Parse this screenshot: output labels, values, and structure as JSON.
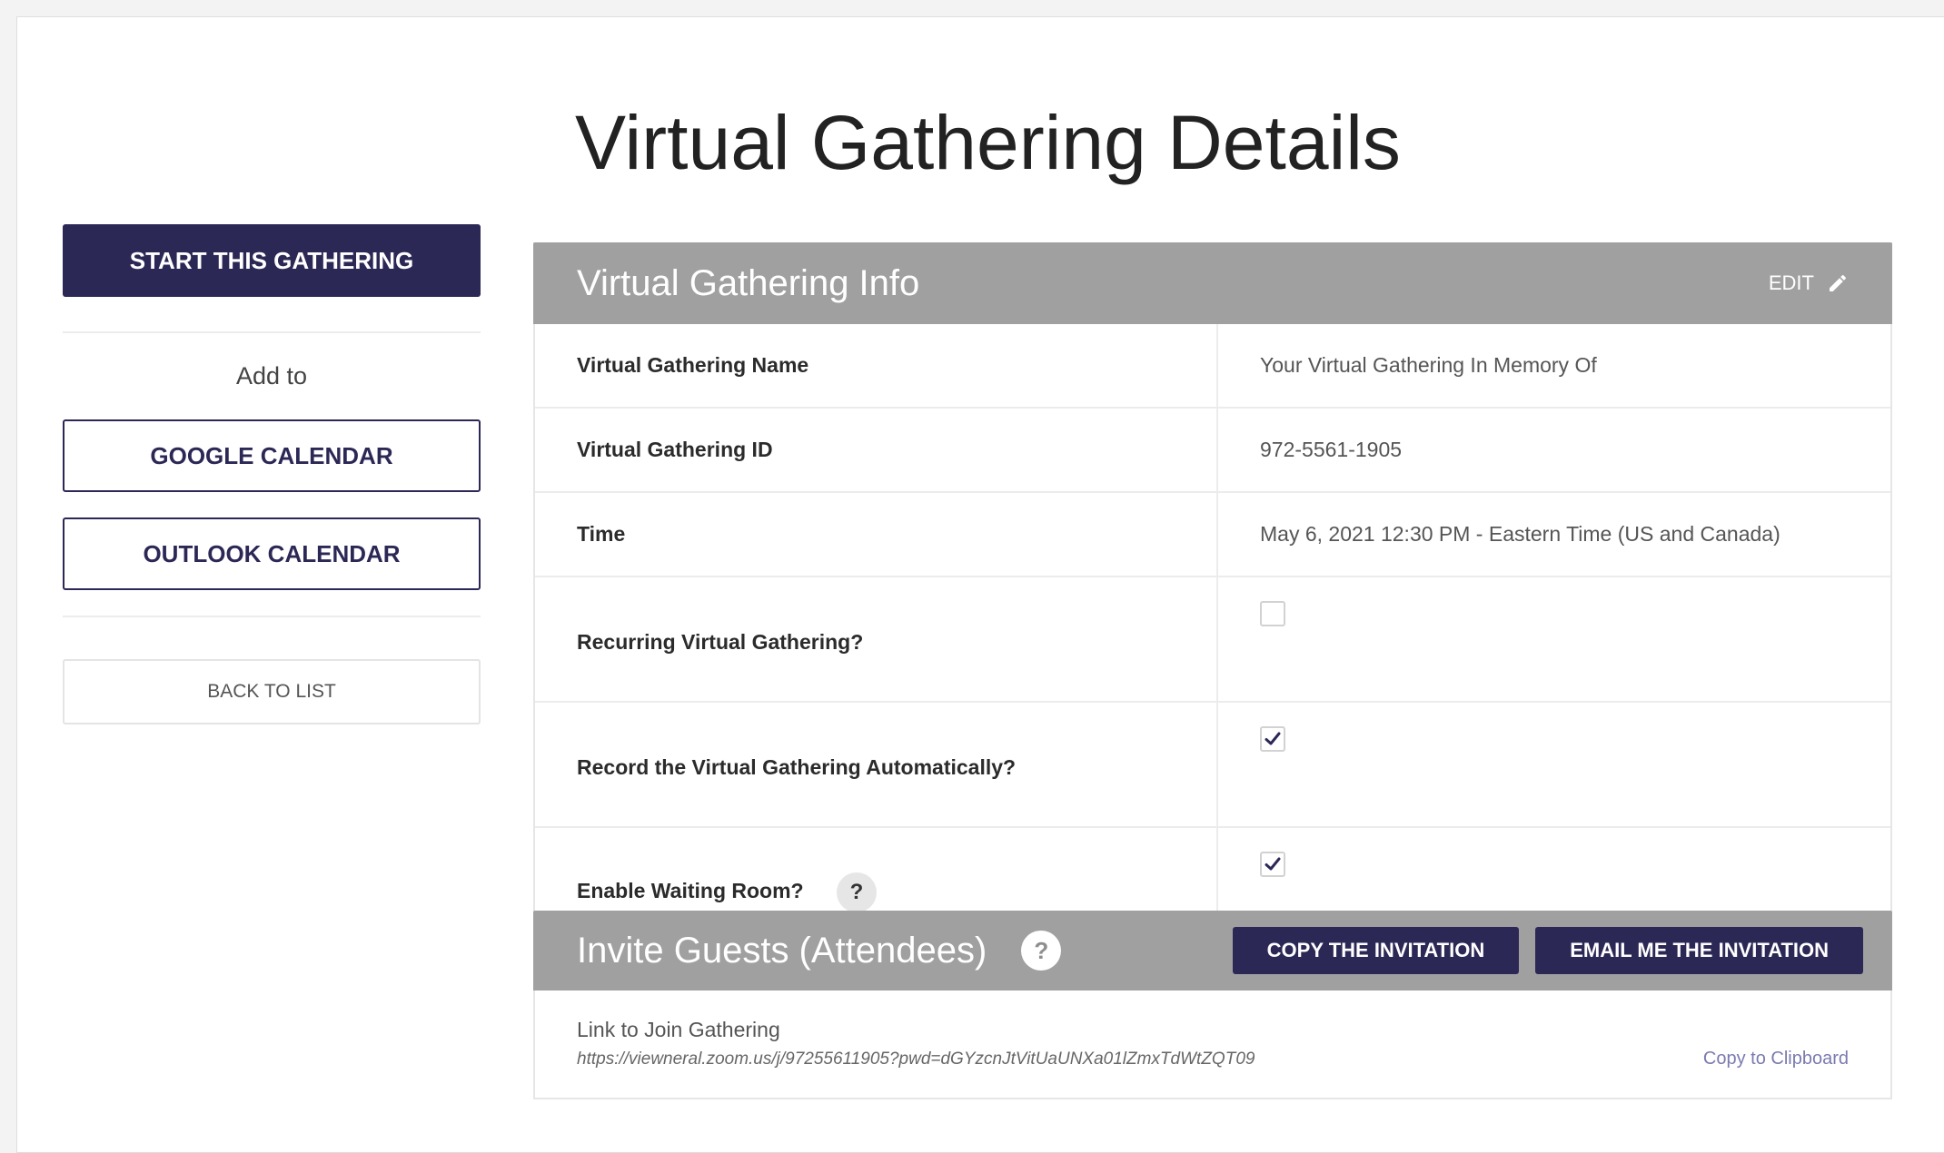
{
  "page": {
    "title": "Virtual Gathering Details"
  },
  "sidebar": {
    "start_label": "START THIS GATHERING",
    "add_to_label": "Add to",
    "google_calendar_label": "GOOGLE CALENDAR",
    "outlook_calendar_label": "OUTLOOK CALENDAR",
    "back_label": "BACK TO LIST"
  },
  "info": {
    "header_title": "Virtual Gathering Info",
    "edit_label": "EDIT",
    "edit_icon": "pencil-icon",
    "rows": [
      {
        "label": "Virtual Gathering Name",
        "value": "Your Virtual Gathering In Memory Of"
      },
      {
        "label": "Virtual Gathering ID",
        "value": "972-5561-1905"
      },
      {
        "label": "Time",
        "value": "May 6, 2021 12:30 PM - Eastern Time (US and Canada)"
      },
      {
        "label": "Recurring Virtual Gathering?",
        "checked": false
      },
      {
        "label": "Record the Virtual Gathering Automatically?",
        "checked": true
      },
      {
        "label": "Enable Waiting Room?",
        "checked": true,
        "help": "?"
      }
    ]
  },
  "invite": {
    "header_title": "Invite Guests (Attendees)",
    "help": "?",
    "copy_button": "COPY THE INVITATION",
    "email_button": "EMAIL ME THE INVITATION",
    "link_label": "Link to Join Gathering",
    "link_url": "https://viewneral.zoom.us/j/97255611905?pwd=dGYzcnJtVitUaUNXa01lZmxTdWtZQT09",
    "copy_clipboard": "Copy to Clipboard"
  },
  "colors": {
    "brand": "#2c2856",
    "header_bg": "#a0a0a1",
    "link": "#7a7ab0"
  }
}
